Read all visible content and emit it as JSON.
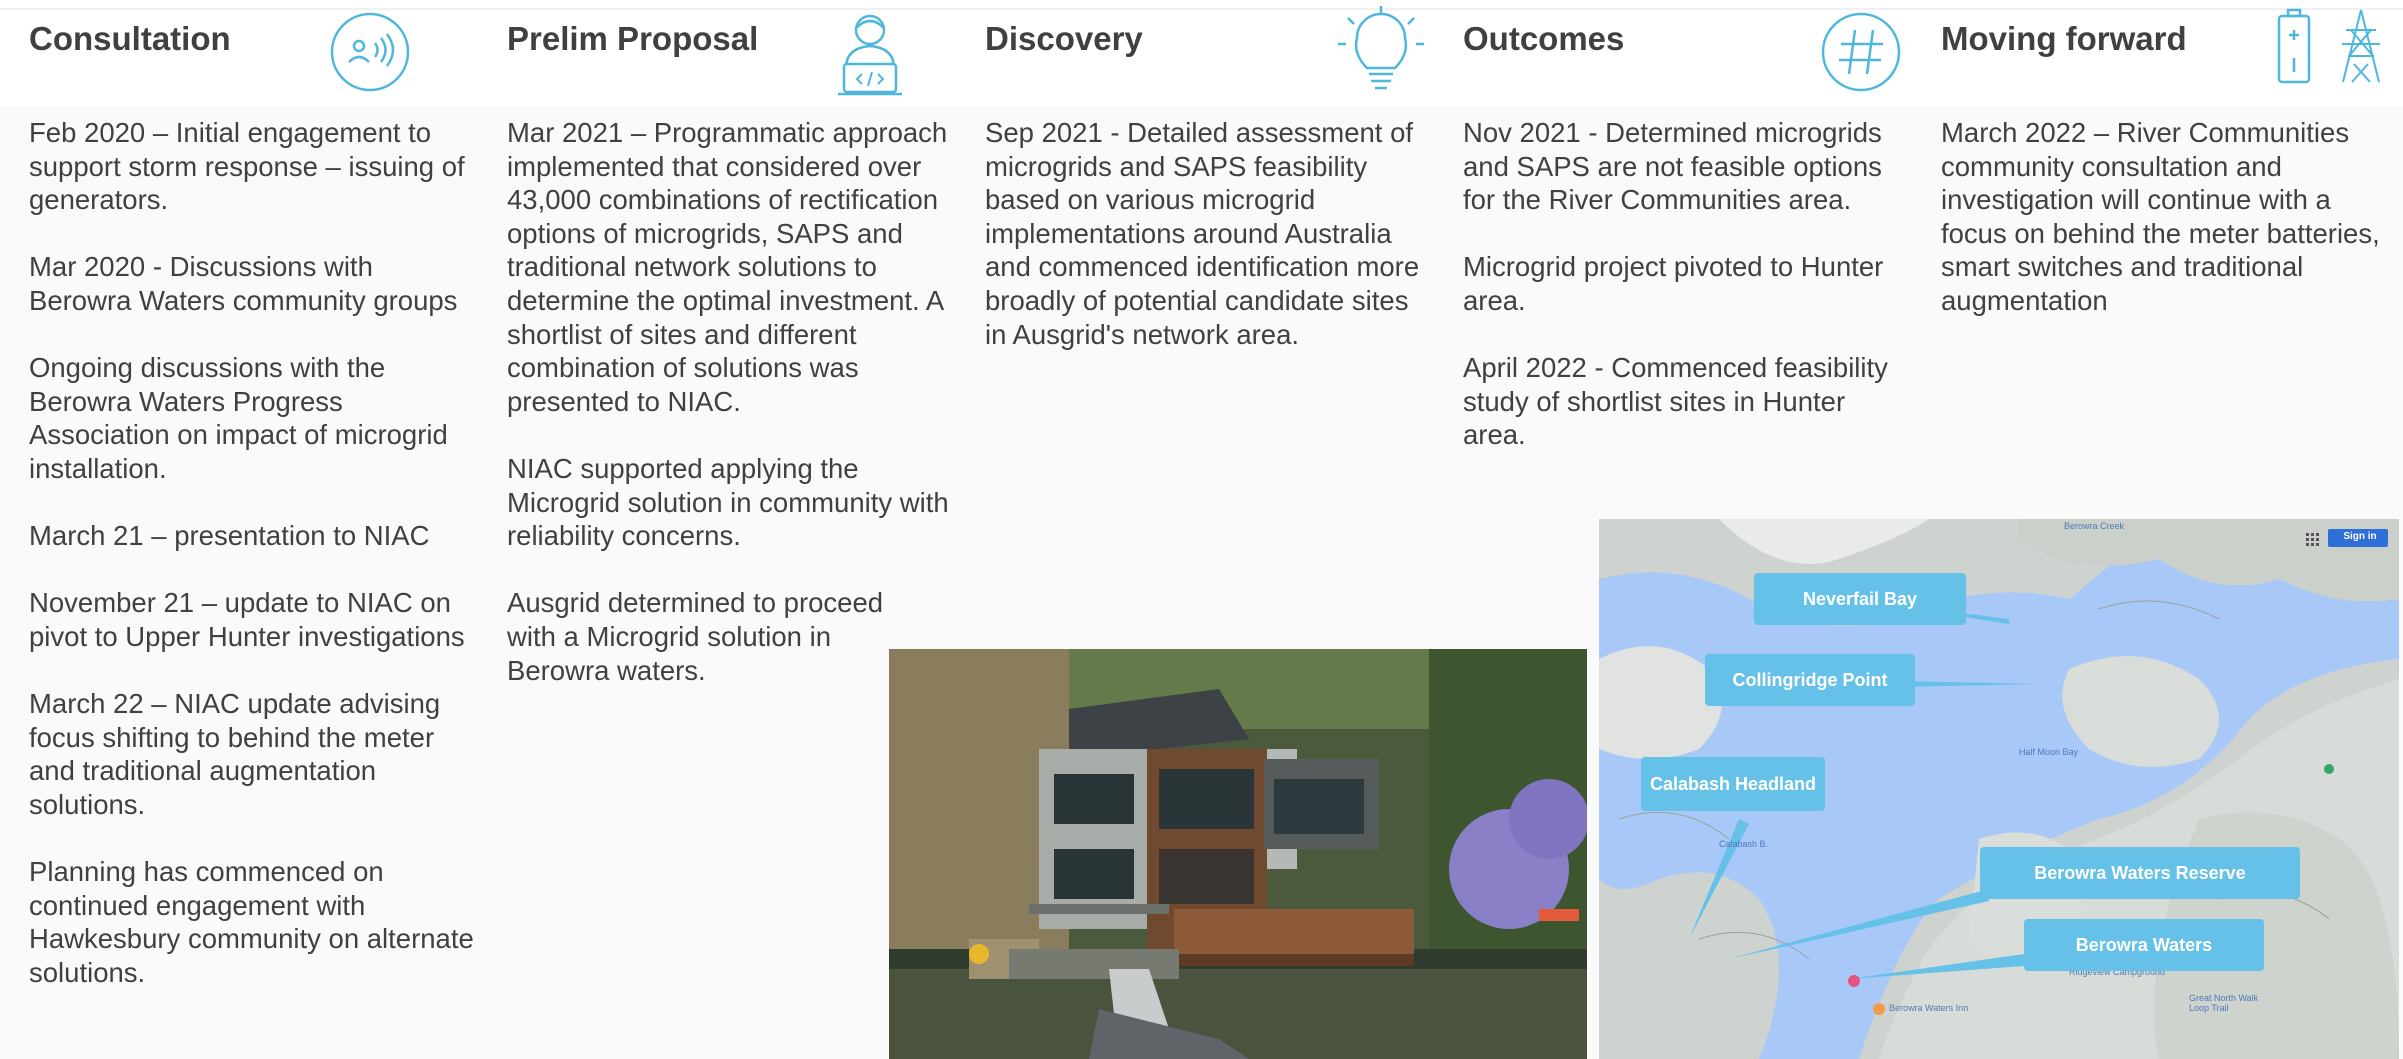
{
  "columns": [
    {
      "title": "Consultation",
      "icon": "broadcast-person-icon",
      "paragraphs": [
        "Feb 2020 – Initial engagement to support storm response – issuing of generators.",
        "Mar 2020 - Discussions with Berowra Waters community groups",
        "Ongoing discussions with the Berowra Waters Progress Association on impact of microgrid installation.",
        "March 21 – presentation to NIAC",
        "November 21 – update to NIAC on pivot to Upper Hunter investigations",
        "March 22 – NIAC update advising focus shifting to behind the meter and traditional augmentation solutions.",
        "Planning has commenced on continued engagement with Hawkesbury community on alternate solutions."
      ]
    },
    {
      "title": "Prelim Proposal",
      "icon": "developer-laptop-icon",
      "paragraphs": [
        "Mar 2021 – Programmatic approach implemented that considered over 43,000 combinations of rectification options of microgrids, SAPS and traditional network solutions to determine the optimal investment. A shortlist of sites and different combination of solutions was presented to NIAC.",
        "NIAC supported applying the Microgrid solution in community with reliability concerns.",
        "Ausgrid determined to proceed with a Microgrid solution in Berowra waters."
      ]
    },
    {
      "title": "Discovery",
      "icon": "lightbulb-icon",
      "paragraphs": [
        "Sep 2021 - Detailed assessment of microgrids and SAPS feasibility based on various microgrid implementations around Australia and commenced identification more broadly of potential candidate sites in Ausgrid's network area."
      ]
    },
    {
      "title": "Outcomes",
      "icon": "hashtag-icon",
      "paragraphs": [
        "Nov 2021 - Determined microgrids and SAPS are not feasible options for the River Communities area.",
        "Microgrid project pivoted to Hunter area.",
        "April 2022 -  Commenced feasibility  study of shortlist sites in Hunter area."
      ]
    },
    {
      "title": "Moving forward",
      "icon": "battery-pylon-icon",
      "paragraphs": [
        "March 2022 – River Communities community consultation and investigation will continue with a focus on behind the meter batteries, smart switches and traditional augmentation"
      ]
    }
  ],
  "map": {
    "callouts": [
      "Neverfail Bay",
      "Collingridge Point",
      "Calabash Headland",
      "Berowra Waters Reserve",
      "Berowra Waters"
    ],
    "sign_in": "Sign in",
    "place_labels": [
      "Berowra Creek",
      "Half Moon Bay",
      "Calabash B.",
      "Ridgeview Campground",
      "Great North Walk Loop Trail",
      "Berowra Waters Inn"
    ]
  },
  "colors": {
    "accent_icon": "#4fb6dc",
    "callout": "#66c1e8",
    "water": "#a8c8f8",
    "title_text": "#404040"
  }
}
